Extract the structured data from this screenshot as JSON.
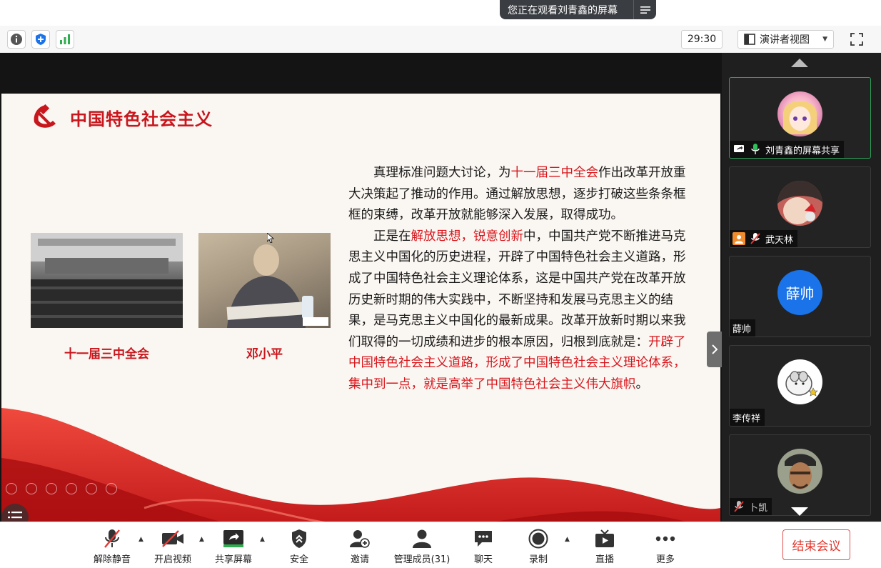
{
  "header": {
    "viewing_text": "您正在观看刘青鑫的屏幕",
    "timer": "29:30",
    "view_mode": "演讲者视图"
  },
  "slide": {
    "title": "中国特色社会主义",
    "caption_left": "十一届三中全会",
    "caption_right": "邓小平",
    "para1_a": "真理标准问题大讨论，为",
    "para1_red": "十一届三中全会",
    "para1_b": "作出改革开放重大决策起了推动的作用。通过解放思想，逐步打破这些条条框框的束缚，改革开放就能够深入发展，取得成功。",
    "para2_a": "正是在",
    "para2_red1": "解放思想，锐意创新",
    "para2_b": "中，中国共产党不断推进马克思主义中国化的历史进程，开辟了中国特色社会主义道路，形成了中国特色社会主义理论体系，这是中国共产党在改革开放历史新时期的伟大实践中，不断坚持和发展马克思主义的结果，是马克思主义中国化的最新成果。改革开放新时期以来我们取得的一切成绩和进步的根本原因，归根到底就是：",
    "para2_red2": "开辟了中国特色社会主义道路，形成了中国特色社会主义理论体系，集中到一点，就是高举了中国特色社会主义伟大旗帜",
    "para2_end": "。"
  },
  "participants": [
    {
      "name": "刘青鑫的屏幕共享",
      "avatar": "anime-girl-avatar",
      "active": true
    },
    {
      "name": "武天林",
      "avatar": "cartoon-boy-avatar",
      "active": false
    },
    {
      "name": "薛帅",
      "avatar_text": "薛帅",
      "avatar_color": "#1a73e8",
      "active": false
    },
    {
      "name": "李传祥",
      "avatar": "hamster-avatar",
      "active": false
    },
    {
      "name": "卜凯",
      "avatar": "basketball-player-avatar",
      "active": false
    }
  ],
  "toolbar": {
    "unmute": "解除静音",
    "start_video": "开启视频",
    "share_screen": "共享屏幕",
    "security": "安全",
    "invite": "邀请",
    "manage_members": "管理成员(31)",
    "chat": "聊天",
    "record": "录制",
    "live": "直播",
    "more": "更多",
    "end_meeting": "结束会议"
  },
  "colors": {
    "accent_red": "#d8161d",
    "active_green": "#2e9e58",
    "end_red": "#e0352b"
  }
}
